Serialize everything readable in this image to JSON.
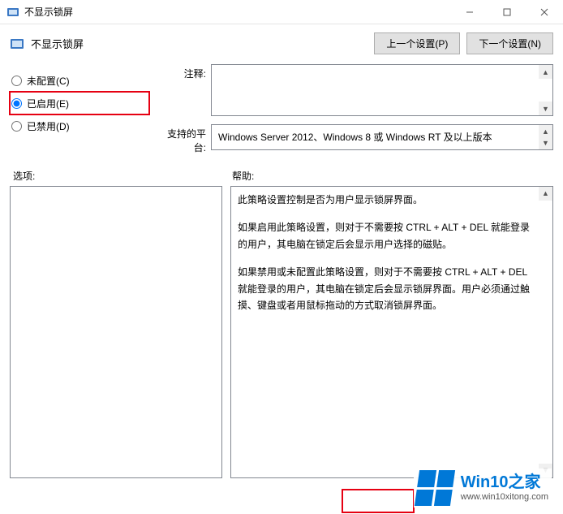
{
  "window": {
    "title": "不显示锁屏"
  },
  "header": {
    "policy_name": "不显示锁屏",
    "prev_button": "上一个设置(P)",
    "next_button": "下一个设置(N)"
  },
  "radios": {
    "not_configured": "未配置(C)",
    "enabled": "已启用(E)",
    "disabled": "已禁用(D)",
    "selected": "enabled"
  },
  "fields": {
    "note_label": "注释:",
    "note_value": "",
    "platform_label": "支持的平台:",
    "platform_value": "Windows Server 2012、Windows 8 或 Windows RT 及以上版本"
  },
  "sections": {
    "options_label": "选项:",
    "help_label": "帮助:"
  },
  "help": {
    "p1": "此策略设置控制是否为用户显示锁屏界面。",
    "p2": "如果启用此策略设置，则对于不需要按 CTRL + ALT + DEL  就能登录的用户，其电脑在锁定后会显示用户选择的磁贴。",
    "p3": "如果禁用或未配置此策略设置，则对于不需要按 CTRL + ALT + DEL 就能登录的用户，其电脑在锁定后会显示锁屏界面。用户必须通过触摸、键盘或者用鼠标拖动的方式取消锁屏界面。"
  },
  "watermark": {
    "brand": "Win10之家",
    "url": "www.win10xitong.com"
  }
}
